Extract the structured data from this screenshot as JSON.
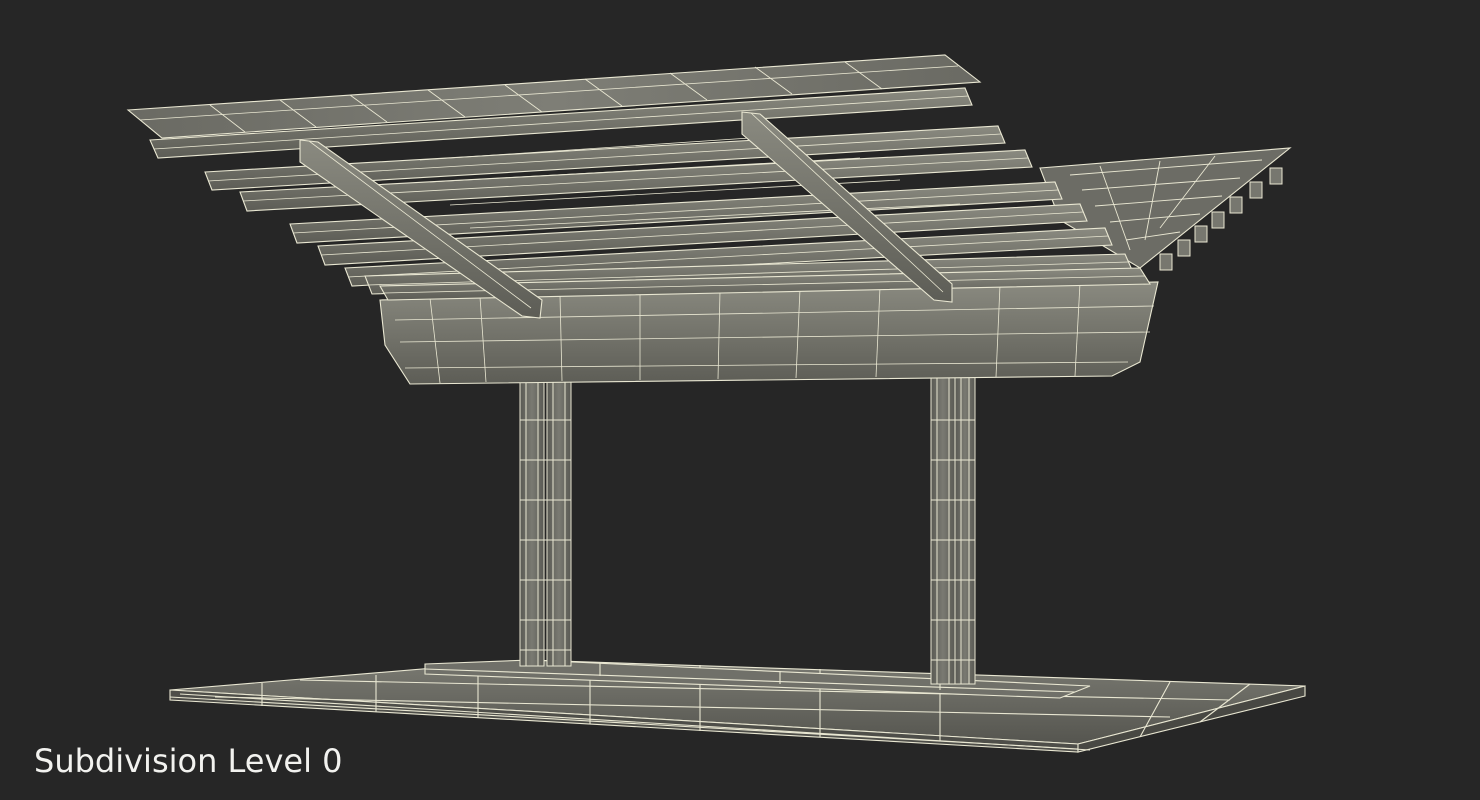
{
  "scene": {
    "caption": "Subdivision Level 0",
    "background_color": "#262626",
    "surface_color": "#6f6f67",
    "wire_color": "#e9e7d2"
  }
}
